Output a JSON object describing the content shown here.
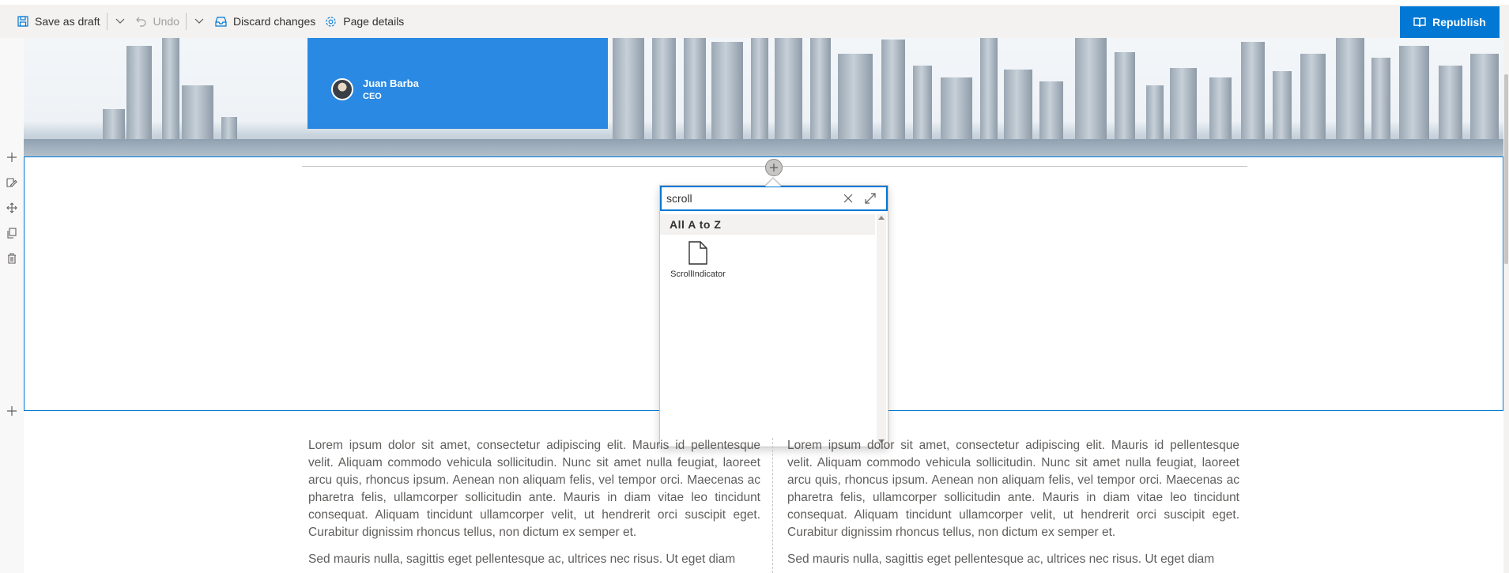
{
  "toolbar": {
    "save_label": "Save as draft",
    "undo_label": "Undo",
    "discard_label": "Discard changes",
    "details_label": "Page details",
    "republish_label": "Republish"
  },
  "header": {
    "author_name": "Juan Barba",
    "author_role": "CEO"
  },
  "toolbox": {
    "search_value": "scroll",
    "category_label": "All A to Z",
    "items": [
      {
        "label": "ScrollIndicator",
        "icon": "document-icon"
      }
    ]
  },
  "content": {
    "left_paragraphs": [
      "Lorem ipsum dolor sit amet, consectetur adipiscing elit. Mauris id pellentesque velit. Aliquam commodo vehicula sollicitudin. Nunc sit amet nulla feugiat, laoreet arcu quis, rhoncus ipsum. Aenean non aliquam felis, vel tempor orci. Maecenas ac pharetra felis, ullamcorper sollicitudin ante. Mauris in diam vitae leo tincidunt consequat. Aliquam tincidunt ullamcorper velit, ut hendrerit orci suscipit eget. Curabitur dignissim rhoncus tellus, non dictum ex semper et.",
      "Sed mauris nulla, sagittis eget pellentesque ac, ultrices nec risus. Ut eget diam"
    ],
    "right_paragraphs": [
      "Lorem ipsum dolor sit amet, consectetur adipiscing elit. Mauris id pellentesque velit. Aliquam commodo vehicula sollicitudin. Nunc sit amet nulla feugiat, laoreet arcu quis, rhoncus ipsum. Aenean non aliquam felis, vel tempor orci. Maecenas ac pharetra felis, ullamcorper sollicitudin ante. Mauris in diam vitae leo tincidunt consequat. Aliquam tincidunt ullamcorper velit, ut hendrerit orci suscipit eget. Curabitur dignissim rhoncus tellus, non dictum ex semper et.",
      "Sed mauris nulla, sagittis eget pellentesque ac, ultrices nec risus. Ut eget diam"
    ]
  },
  "colors": {
    "accent": "#0078d4",
    "author_box": "#1980e1",
    "command_bar": "#f3f2f1"
  }
}
